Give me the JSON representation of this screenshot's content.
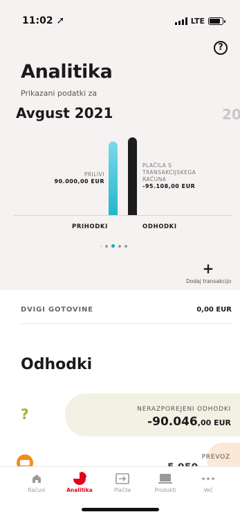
{
  "status_bar": {
    "time": "11:02",
    "network": "LTE"
  },
  "header": {
    "title": "Analitika",
    "subtitle": "Prikazani podatki za",
    "month": "Avgust 2021",
    "next_month_peek": "20"
  },
  "chart_data": {
    "type": "bar",
    "categories": [
      "PRIHODKI",
      "ODHODKI"
    ],
    "values": [
      90000.0,
      95108.0
    ],
    "ylim": [
      0,
      95108.0
    ],
    "labels": {
      "income_title": "PRILIVI",
      "income_value": "90.000,00 EUR",
      "expense_title_1": "PLAČILA S",
      "expense_title_2": "TRANSAKCIJSKEGA",
      "expense_title_3": "RAČUNA",
      "expense_value": "-95.108,00 EUR"
    },
    "colors": {
      "income": "#21b7cf",
      "expense": "#1c1c1c"
    }
  },
  "add_transaction": {
    "label": "Dodaj transakcijo"
  },
  "cash_withdrawals": {
    "label": "DVIGI GOTOVINE",
    "value": "0,00 EUR"
  },
  "expenses_section": {
    "title": "Odhodki",
    "unassigned": {
      "icon_glyph": "?",
      "label": "NERAZPOREJENI ODHODKI",
      "value_main": "-90.046",
      "value_cents": ",00 EUR"
    },
    "transport": {
      "label": "PREVOZ",
      "value_peek": "5.950"
    }
  },
  "tab_bar": [
    {
      "label": "Računi",
      "icon": "home-icon"
    },
    {
      "label": "Analitika",
      "icon": "pie-chart-icon",
      "active": true
    },
    {
      "label": "Plačila",
      "icon": "transfer-icon"
    },
    {
      "label": "Produkti",
      "icon": "products-icon"
    },
    {
      "label": "Več",
      "icon": "more-icon"
    }
  ],
  "colors": {
    "accent": "#e3021b",
    "background_top": "#f5f2f1"
  }
}
